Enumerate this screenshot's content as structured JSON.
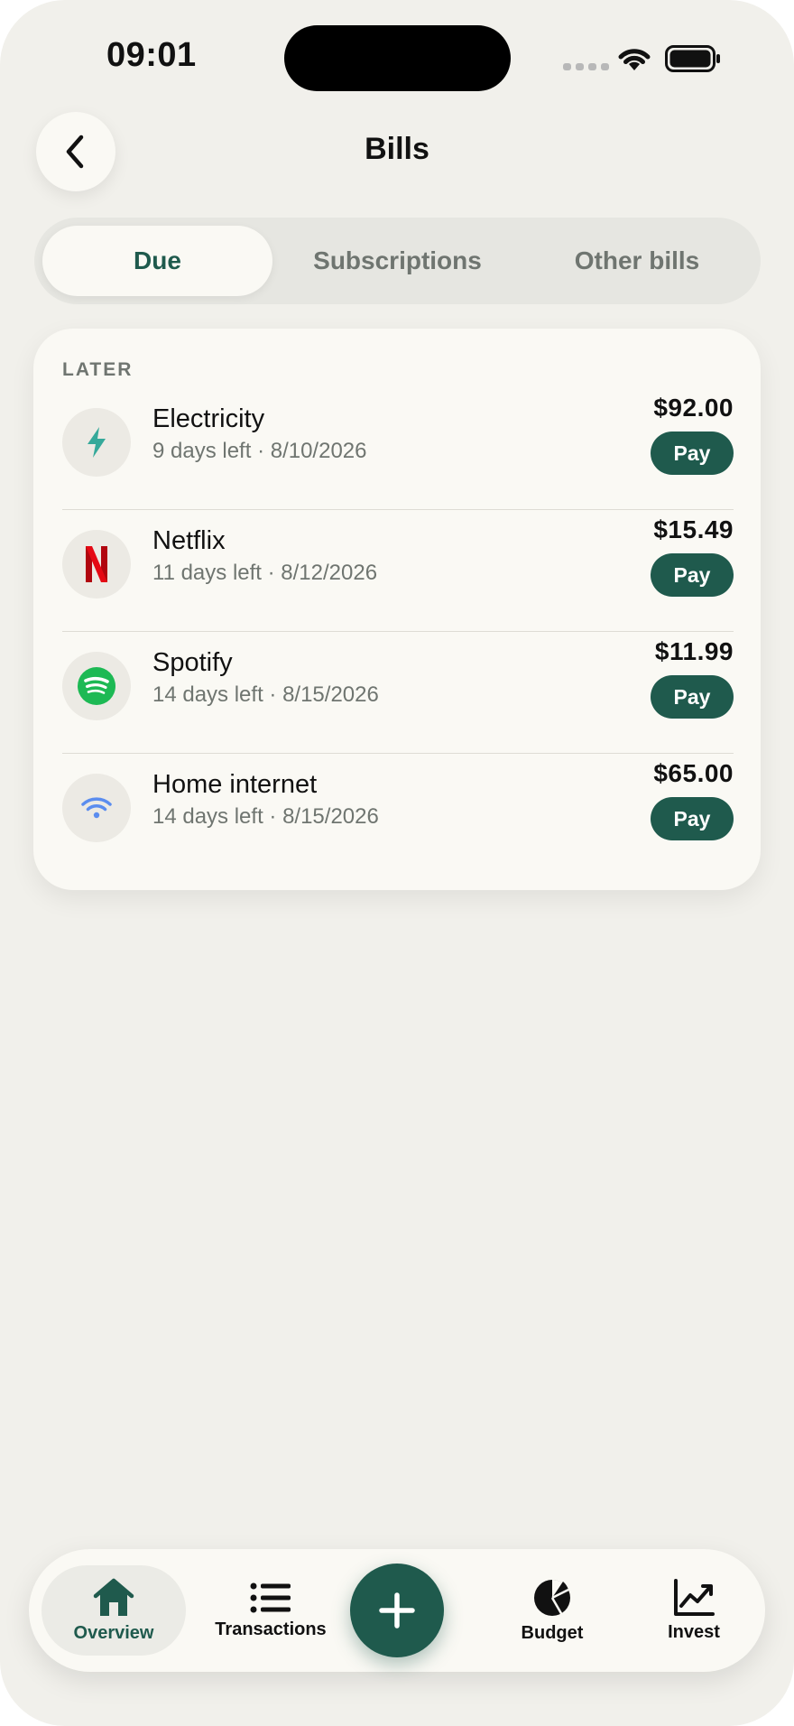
{
  "status_bar": {
    "time": "09:01"
  },
  "header": {
    "title": "Bills"
  },
  "tabs": [
    {
      "label": "Due",
      "active": true
    },
    {
      "label": "Subscriptions",
      "active": false
    },
    {
      "label": "Other bills",
      "active": false
    }
  ],
  "section": {
    "label": "LATER"
  },
  "bills": [
    {
      "name": "Electricity",
      "meta": "9 days left · 8/10/2026",
      "amount": "$92.00",
      "pay_label": "Pay",
      "icon": "lightning-icon",
      "icon_color": "#35a99a"
    },
    {
      "name": "Netflix",
      "meta": "11 days left · 8/12/2026",
      "amount": "$15.49",
      "pay_label": "Pay",
      "icon": "netflix-icon",
      "icon_color": "#e50914"
    },
    {
      "name": "Spotify",
      "meta": "14 days left · 8/15/2026",
      "amount": "$11.99",
      "pay_label": "Pay",
      "icon": "spotify-icon",
      "icon_color": "#1db954"
    },
    {
      "name": "Home internet",
      "meta": "14 days left · 8/15/2026",
      "amount": "$65.00",
      "pay_label": "Pay",
      "icon": "wifi-icon",
      "icon_color": "#5b8def"
    }
  ],
  "bottom_nav": {
    "items": [
      {
        "label": "Overview",
        "icon": "home-icon",
        "active": true
      },
      {
        "label": "Transactions",
        "icon": "list-icon",
        "active": false
      },
      {
        "label": "Budget",
        "icon": "pie-chart-icon",
        "active": false
      },
      {
        "label": "Invest",
        "icon": "chart-line-icon",
        "active": false
      }
    ],
    "add_icon": "plus-icon"
  },
  "colors": {
    "accent": "#1f5a4d",
    "background": "#f1f0eb",
    "card": "#faf9f4",
    "muted_text": "#6f7570"
  }
}
